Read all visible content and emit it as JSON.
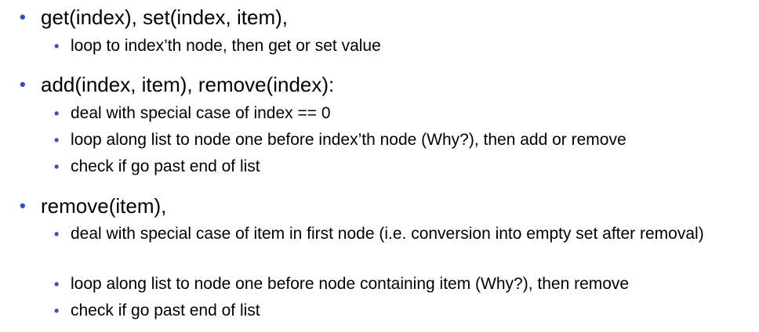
{
  "bullet_color": "#3a4fbf",
  "sections": [
    {
      "heading": "get(index), set(index, item),",
      "items": [
        "loop to index’th node, then get or set value"
      ]
    },
    {
      "heading": "add(index, item), remove(index):",
      "items": [
        "deal with special case of index == 0",
        "loop along list to node one before index’th node (Why?), then add or remove",
        "check if go past end of list"
      ]
    },
    {
      "heading": "remove(item),",
      "items": [
        "deal with special case of item in first node (i.e. conversion into empty set after removal)",
        "loop along list to node one before node containing item (Why?), then remove",
        "check if go past end of list"
      ]
    }
  ]
}
